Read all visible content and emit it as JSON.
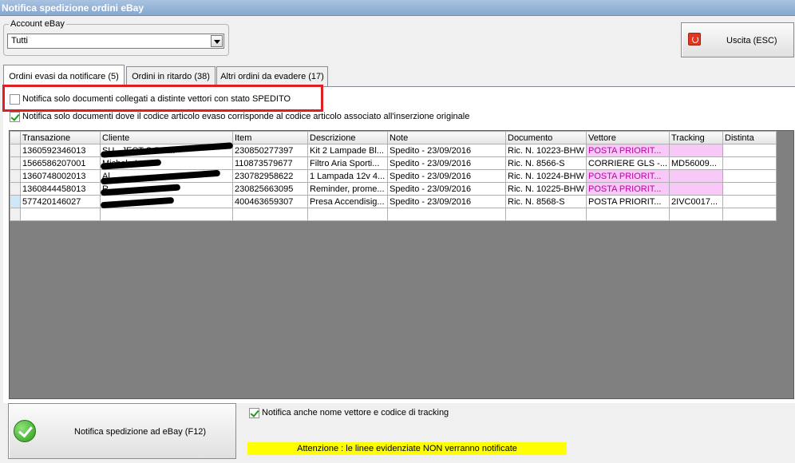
{
  "window": {
    "title": "Notifica spedizione ordini eBay"
  },
  "account": {
    "legend": "Account eBay",
    "selected": "Tutti"
  },
  "exit_button": {
    "label": "Uscita (ESC)"
  },
  "tabs": [
    {
      "label": "Ordini evasi da notificare (5)",
      "active": true
    },
    {
      "label": "Ordini in ritardo (38)",
      "active": false
    },
    {
      "label": "Altri ordini da evadere (17)",
      "active": false
    }
  ],
  "options": {
    "only_shipped": {
      "label": "Notifica solo documenti  collegati a distinte vettori con stato SPEDITO",
      "checked": false
    },
    "match_code": {
      "label": "Notifica solo documenti dove il codice articolo evaso corrisponde al codice articolo associato all'inserzione originale",
      "checked": true
    },
    "carrier_tracking": {
      "label": "Notifica anche nome vettore e codice di tracking",
      "checked": true
    }
  },
  "grid": {
    "columns": [
      "",
      "Transazione",
      "Cliente",
      "Item",
      "Descrizione",
      "Note",
      "Documento",
      "Vettore",
      "Tracking",
      "Distinta"
    ],
    "rows": [
      {
        "transazione": "1360592346013",
        "cliente": "SU...JECT S.R.L...",
        "item": "230850277397",
        "descrizione": "Kit 2 Lampade Bl...",
        "note": "Spedito - 23/09/2016",
        "documento": "Ric. N. 10223-BHW",
        "vettore": "POSTA PRIORIT...",
        "tracking": "",
        "distinta": "",
        "highlight": true
      },
      {
        "transazione": "1566586207001",
        "cliente": "Michele La...",
        "item": "110873579677",
        "descrizione": "Filtro Aria Sporti...",
        "note": "Spedito - 23/09/2016",
        "documento": "Ric. N. 8566-S",
        "vettore": "CORRIERE GLS -...",
        "tracking": "MD56009...",
        "distinta": "",
        "highlight": false
      },
      {
        "transazione": "1360748002013",
        "cliente": "Al...",
        "item": "230782958622",
        "descrizione": "1 Lampada 12v 4...",
        "note": "Spedito - 23/09/2016",
        "documento": "Ric. N. 10224-BHW",
        "vettore": "POSTA PRIORIT...",
        "tracking": "",
        "distinta": "",
        "highlight": true
      },
      {
        "transazione": "1360844458013",
        "cliente": "R...",
        "item": "230825663095",
        "descrizione": "Reminder, prome...",
        "note": "Spedito - 23/09/2016",
        "documento": "Ric. N. 10225-BHW",
        "vettore": "POSTA PRIORIT...",
        "tracking": "",
        "distinta": "",
        "highlight": true
      },
      {
        "transazione": "577420146027",
        "cliente": "",
        "item": "400463659307",
        "descrizione": "Presa Accendisig...",
        "note": "Spedito - 23/09/2016",
        "documento": "Ric. N. 8568-S",
        "vettore": "POSTA PRIORIT...",
        "tracking": "2IVC0017...",
        "distinta": "",
        "highlight": false
      }
    ]
  },
  "notify_button": {
    "label": "Notifica spedizione ad eBay (F12)"
  },
  "warning": {
    "text": "Attenzione : le linee evidenziate NON verranno notificate"
  },
  "colors": {
    "highlight_row": "#f8c8f8",
    "warning_bg": "#ffff00",
    "annotation_box": "#e02020"
  }
}
